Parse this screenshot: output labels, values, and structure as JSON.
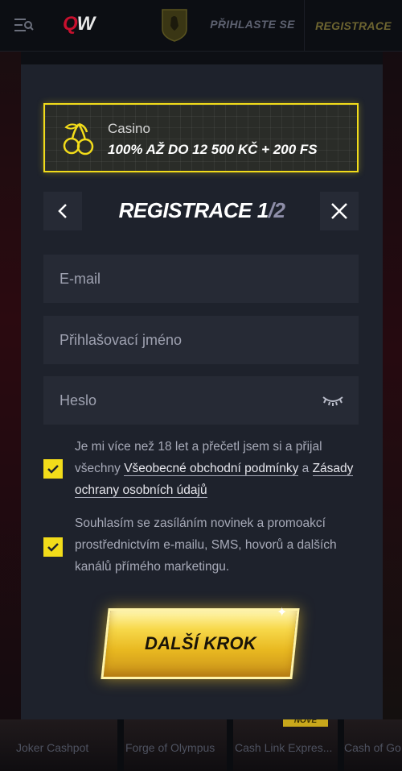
{
  "nav": {
    "logo_q": "Q",
    "logo_w": "W",
    "login_label": "PŘIHLASTE SE",
    "register_label": "REGISTRACE"
  },
  "promo": {
    "label": "Casino",
    "offer": "100% AŽ DO 12 500 KČ + 200 FS"
  },
  "registration": {
    "title": "REGISTRACE",
    "step": "1",
    "separator": "/",
    "total": "2"
  },
  "fields": {
    "email_placeholder": "E-mail",
    "username_placeholder": "Přihlašovací jméno",
    "password_placeholder": "Heslo"
  },
  "consent": {
    "age_text_before": "Je mi více než 18 let a přečetl jsem si a přijal všechny",
    "terms_link": "Všeobecné obchodní podmínky",
    "and": "a",
    "privacy_link": "Zásady ochrany osobních údajů",
    "marketing_text": "Souhlasím se zasíláním novinek a promoakcí prostřednictvím e-mailu, SMS, hovorů a dalších kanálů přímého marketingu.",
    "age_checked": true,
    "marketing_checked": true
  },
  "next_button": "DALŠÍ KROK",
  "games": [
    {
      "name": "Joker Cashpot"
    },
    {
      "name": "Forge of Olympus"
    },
    {
      "name": "Cash Link Expres..."
    },
    {
      "name": "Cash of Go"
    }
  ],
  "badge_new": "NOVÉ",
  "colors": {
    "accent_yellow": "#f2dc1a",
    "modal_bg": "#1e222c",
    "field_bg": "#262a35"
  }
}
